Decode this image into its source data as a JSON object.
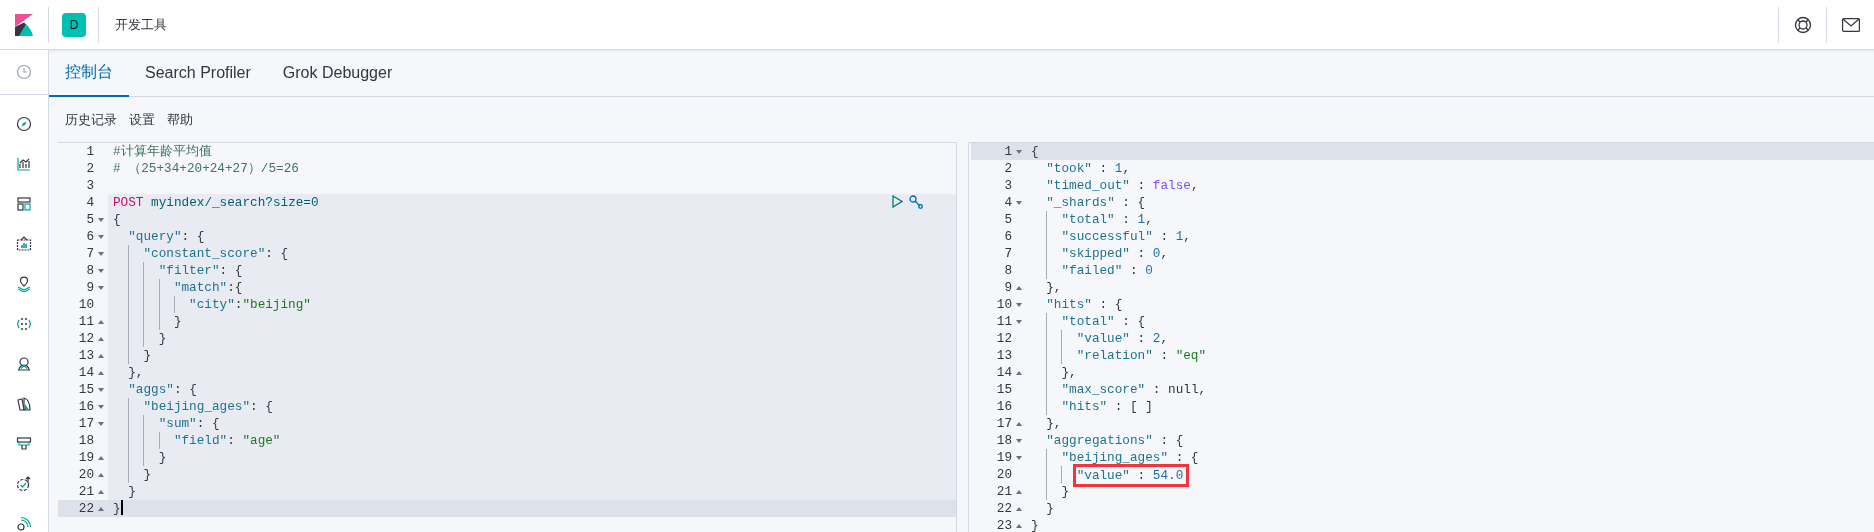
{
  "header": {
    "badge": "D",
    "title": "开发工具"
  },
  "tabs": [
    {
      "label": "控制台",
      "selected": true
    },
    {
      "label": "Search Profiler",
      "selected": false
    },
    {
      "label": "Grok Debugger",
      "selected": false
    }
  ],
  "toolbar": [
    "历史记录",
    "设置",
    "帮助"
  ],
  "request": {
    "lines": [
      {
        "num": "1",
        "active": false,
        "block": false,
        "tokens": [
          {
            "kind": "comment",
            "text": "#计算年龄平均值"
          }
        ]
      },
      {
        "num": "2",
        "active": false,
        "block": false,
        "tokens": [
          {
            "kind": "comment",
            "text": "# （25+34+20+24+27）/5=26"
          }
        ]
      },
      {
        "num": "3",
        "active": false,
        "block": false
      },
      {
        "num": "4",
        "active": false,
        "block": true,
        "tokens": [
          {
            "kind": "method",
            "text": "POST"
          },
          {
            "kind": "url",
            "text": " myindex/_search?size=0"
          }
        ]
      },
      {
        "num": "5",
        "fold": {
          "kind": "open"
        },
        "active": false,
        "block": true,
        "tokens": [
          {
            "kind": "punct",
            "text": "{"
          }
        ]
      },
      {
        "num": "6",
        "fold": {
          "kind": "open"
        },
        "active": false,
        "block": true,
        "tokens": [
          {
            "kind": "key",
            "text": "  \"query\""
          },
          {
            "kind": "punct",
            "text": ": {"
          }
        ]
      },
      {
        "num": "7",
        "fold": {
          "kind": "open"
        },
        "active": false,
        "block": true,
        "tokens": [
          {
            "kind": "key",
            "text": "    \"constant_score\""
          },
          {
            "kind": "punct",
            "text": ": {"
          }
        ]
      },
      {
        "num": "8",
        "fold": {
          "kind": "open"
        },
        "active": false,
        "block": true,
        "tokens": [
          {
            "kind": "key",
            "text": "      \"filter\""
          },
          {
            "kind": "punct",
            "text": ": {"
          }
        ]
      },
      {
        "num": "9",
        "fold": {
          "kind": "open"
        },
        "active": false,
        "block": true,
        "tokens": [
          {
            "kind": "key",
            "text": "        \"match\""
          },
          {
            "kind": "punct",
            "text": ":{"
          }
        ]
      },
      {
        "num": "10",
        "active": false,
        "block": true,
        "tokens": [
          {
            "kind": "key",
            "text": "          \"city\""
          },
          {
            "kind": "punct",
            "text": ":"
          },
          {
            "kind": "string",
            "text": "\"beijing\""
          }
        ]
      },
      {
        "num": "11",
        "fold": {
          "kind": "close"
        },
        "active": false,
        "block": true,
        "tokens": [
          {
            "kind": "punct",
            "text": "        }"
          }
        ]
      },
      {
        "num": "12",
        "fold": {
          "kind": "close"
        },
        "active": false,
        "block": true,
        "tokens": [
          {
            "kind": "punct",
            "text": "      }"
          }
        ]
      },
      {
        "num": "13",
        "fold": {
          "kind": "close"
        },
        "active": false,
        "block": true,
        "tokens": [
          {
            "kind": "punct",
            "text": "    }"
          }
        ]
      },
      {
        "num": "14",
        "fold": {
          "kind": "close"
        },
        "active": false,
        "block": true,
        "tokens": [
          {
            "kind": "punct",
            "text": "  },"
          }
        ]
      },
      {
        "num": "15",
        "fold": {
          "kind": "open"
        },
        "active": false,
        "block": true,
        "tokens": [
          {
            "kind": "key",
            "text": "  \"aggs\""
          },
          {
            "kind": "punct",
            "text": ": {"
          }
        ]
      },
      {
        "num": "16",
        "fold": {
          "kind": "open"
        },
        "active": false,
        "block": true,
        "tokens": [
          {
            "kind": "key",
            "text": "    \"beijing_ages\""
          },
          {
            "kind": "punct",
            "text": ": {"
          }
        ]
      },
      {
        "num": "17",
        "fold": {
          "kind": "open"
        },
        "active": false,
        "block": true,
        "tokens": [
          {
            "kind": "key",
            "text": "      \"sum\""
          },
          {
            "kind": "punct",
            "text": ": {"
          }
        ]
      },
      {
        "num": "18",
        "active": false,
        "block": true,
        "tokens": [
          {
            "kind": "key",
            "text": "        \"field\""
          },
          {
            "kind": "punct",
            "text": ": "
          },
          {
            "kind": "string",
            "text": "\"age\""
          }
        ]
      },
      {
        "num": "19",
        "fold": {
          "kind": "close"
        },
        "active": false,
        "block": true,
        "tokens": [
          {
            "kind": "punct",
            "text": "      }"
          }
        ]
      },
      {
        "num": "20",
        "fold": {
          "kind": "close"
        },
        "active": false,
        "block": true,
        "tokens": [
          {
            "kind": "punct",
            "text": "    }"
          }
        ]
      },
      {
        "num": "21",
        "fold": {
          "kind": "close"
        },
        "active": false,
        "block": true,
        "tokens": [
          {
            "kind": "punct",
            "text": "  }"
          }
        ]
      },
      {
        "num": "22",
        "fold": {
          "kind": "close"
        },
        "active": true,
        "block": false,
        "tokens": [
          {
            "kind": "punct",
            "text": "}"
          }
        ]
      }
    ]
  },
  "response": {
    "lines": [
      {
        "num": "1",
        "fold": {
          "kind": "open"
        },
        "active": true,
        "marked": false,
        "tokens": [
          {
            "kind": "punct",
            "text": "{"
          }
        ]
      },
      {
        "num": "2",
        "active": false,
        "marked": false,
        "tokens": [
          {
            "kind": "key",
            "text": "  \"took\""
          },
          {
            "kind": "punct",
            "text": " : "
          },
          {
            "kind": "number",
            "text": "1"
          },
          {
            "kind": "punct",
            "text": ","
          }
        ]
      },
      {
        "num": "3",
        "active": false,
        "marked": false,
        "tokens": [
          {
            "kind": "key",
            "text": "  \"timed_out\""
          },
          {
            "kind": "punct",
            "text": " : "
          },
          {
            "kind": "bool",
            "text": "false"
          },
          {
            "kind": "punct",
            "text": ","
          }
        ]
      },
      {
        "num": "4",
        "fold": {
          "kind": "open"
        },
        "active": false,
        "marked": false,
        "tokens": [
          {
            "kind": "key",
            "text": "  \"_shards\""
          },
          {
            "kind": "punct",
            "text": " : {"
          }
        ]
      },
      {
        "num": "5",
        "active": false,
        "marked": false,
        "tokens": [
          {
            "kind": "key",
            "text": "    \"total\""
          },
          {
            "kind": "punct",
            "text": " : "
          },
          {
            "kind": "number",
            "text": "1"
          },
          {
            "kind": "punct",
            "text": ","
          }
        ]
      },
      {
        "num": "6",
        "active": false,
        "marked": false,
        "tokens": [
          {
            "kind": "key",
            "text": "    \"successful\""
          },
          {
            "kind": "punct",
            "text": " : "
          },
          {
            "kind": "number",
            "text": "1"
          },
          {
            "kind": "punct",
            "text": ","
          }
        ]
      },
      {
        "num": "7",
        "active": false,
        "marked": false,
        "tokens": [
          {
            "kind": "key",
            "text": "    \"skipped\""
          },
          {
            "kind": "punct",
            "text": " : "
          },
          {
            "kind": "number",
            "text": "0"
          },
          {
            "kind": "punct",
            "text": ","
          }
        ]
      },
      {
        "num": "8",
        "active": false,
        "marked": false,
        "tokens": [
          {
            "kind": "key",
            "text": "    \"failed\""
          },
          {
            "kind": "punct",
            "text": " : "
          },
          {
            "kind": "number",
            "text": "0"
          }
        ]
      },
      {
        "num": "9",
        "fold": {
          "kind": "close"
        },
        "active": false,
        "marked": false,
        "tokens": [
          {
            "kind": "punct",
            "text": "  },"
          }
        ]
      },
      {
        "num": "10",
        "fold": {
          "kind": "open"
        },
        "active": false,
        "marked": false,
        "tokens": [
          {
            "kind": "key",
            "text": "  \"hits\""
          },
          {
            "kind": "punct",
            "text": " : {"
          }
        ]
      },
      {
        "num": "11",
        "fold": {
          "kind": "open"
        },
        "active": false,
        "marked": false,
        "tokens": [
          {
            "kind": "key",
            "text": "    \"total\""
          },
          {
            "kind": "punct",
            "text": " : {"
          }
        ]
      },
      {
        "num": "12",
        "active": false,
        "marked": false,
        "tokens": [
          {
            "kind": "key",
            "text": "      \"value\""
          },
          {
            "kind": "punct",
            "text": " : "
          },
          {
            "kind": "number",
            "text": "2"
          },
          {
            "kind": "punct",
            "text": ","
          }
        ]
      },
      {
        "num": "13",
        "active": false,
        "marked": false,
        "tokens": [
          {
            "kind": "key",
            "text": "      \"relation\""
          },
          {
            "kind": "punct",
            "text": " : "
          },
          {
            "kind": "string",
            "text": "\"eq\""
          }
        ]
      },
      {
        "num": "14",
        "fold": {
          "kind": "close"
        },
        "active": false,
        "marked": false,
        "tokens": [
          {
            "kind": "punct",
            "text": "    },"
          }
        ]
      },
      {
        "num": "15",
        "active": false,
        "marked": false,
        "tokens": [
          {
            "kind": "key",
            "text": "    \"max_score\""
          },
          {
            "kind": "punct",
            "text": " : "
          },
          {
            "kind": "null",
            "text": "null"
          },
          {
            "kind": "punct",
            "text": ","
          }
        ]
      },
      {
        "num": "16",
        "active": false,
        "marked": false,
        "tokens": [
          {
            "kind": "key",
            "text": "    \"hits\""
          },
          {
            "kind": "punct",
            "text": " : [ ]"
          }
        ]
      },
      {
        "num": "17",
        "fold": {
          "kind": "close"
        },
        "active": false,
        "marked": false,
        "tokens": [
          {
            "kind": "punct",
            "text": "  },"
          }
        ]
      },
      {
        "num": "18",
        "fold": {
          "kind": "open"
        },
        "active": false,
        "marked": false,
        "tokens": [
          {
            "kind": "key",
            "text": "  \"aggregations\""
          },
          {
            "kind": "punct",
            "text": " : {"
          }
        ]
      },
      {
        "num": "19",
        "fold": {
          "kind": "open"
        },
        "active": false,
        "marked": false,
        "tokens": [
          {
            "kind": "key",
            "text": "    \"beijing_ages\""
          },
          {
            "kind": "punct",
            "text": " : {"
          }
        ]
      },
      {
        "num": "20",
        "active": false,
        "marked": true,
        "tokens": [
          {
            "kind": "key",
            "text": "      \"value\""
          },
          {
            "kind": "punct",
            "text": " : "
          },
          {
            "kind": "number",
            "text": "54.0"
          }
        ]
      },
      {
        "num": "21",
        "fold": {
          "kind": "close"
        },
        "active": false,
        "marked": false,
        "tokens": [
          {
            "kind": "punct",
            "text": "    }"
          }
        ]
      },
      {
        "num": "22",
        "fold": {
          "kind": "close"
        },
        "active": false,
        "marked": false,
        "tokens": [
          {
            "kind": "punct",
            "text": "  }"
          }
        ]
      },
      {
        "num": "23",
        "fold": {
          "kind": "close"
        },
        "active": false,
        "marked": false,
        "tokens": [
          {
            "kind": "punct",
            "text": "}"
          }
        ]
      }
    ]
  }
}
